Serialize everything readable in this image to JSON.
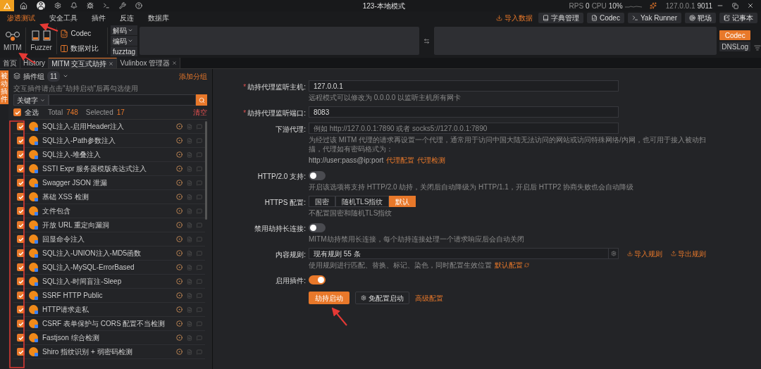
{
  "title_bar": {
    "title": "123-本地模式",
    "rps_label": "RPS",
    "rps": "0",
    "cpu_label": "CPU",
    "cpu": "10%",
    "host": "127.0.0.1",
    "port": "9011"
  },
  "ribbon_tabs": [
    {
      "label": "渗透测试",
      "selected": true
    },
    {
      "label": "安全工具",
      "selected": false
    },
    {
      "label": "插件",
      "selected": false
    },
    {
      "label": "反连",
      "selected": false
    },
    {
      "label": "数据库",
      "selected": false
    }
  ],
  "ribbon_tools": [
    {
      "label": "导入数据",
      "kind": "link"
    },
    {
      "label": "字典管理",
      "kind": "button"
    },
    {
      "label": "Codec",
      "kind": "button"
    },
    {
      "label": "Yak Runner",
      "kind": "button"
    },
    {
      "label": "靶场",
      "kind": "button"
    },
    {
      "label": "记事本",
      "kind": "button"
    }
  ],
  "ribbon": {
    "mitm": "MITM",
    "fuzzer": "Fuzzer",
    "codec": "Codec",
    "compare": "数据对比",
    "decode": "解码",
    "encode": "编码",
    "fuzztag": "fuzztag",
    "side_buttons": [
      {
        "label": "Codec",
        "selected": true
      },
      {
        "label": "DNSLog",
        "selected": false
      }
    ]
  },
  "page_tabs": [
    {
      "label": "首页",
      "selected": false,
      "closable": false
    },
    {
      "label": "History",
      "selected": false,
      "closable": false
    },
    {
      "label": "MITM 交互式劫持",
      "selected": true,
      "closable": true
    },
    {
      "label": "Vulinbox 管理器",
      "selected": false,
      "closable": true
    }
  ],
  "side_tab": "被动插件",
  "plugins": {
    "group_label": "插件组",
    "group_count": "11",
    "add_group": "添加分组",
    "hint": "交互插件请点击\"劫持启动\"后再勾选使用",
    "keyword": "关键字",
    "select_all_label": "全选",
    "select_all_checked": true,
    "total_label": "Total",
    "total": "748",
    "selected_label": "Selected",
    "selected": "17",
    "clear": "清空",
    "items": [
      {
        "name": "SQL注入-启用Header注入",
        "checked": true
      },
      {
        "name": "SQL注入-Path参数注入",
        "checked": true
      },
      {
        "name": "SQL注入-堆叠注入",
        "checked": true
      },
      {
        "name": "SSTI Expr 服务器模版表达式注入",
        "checked": true
      },
      {
        "name": "Swagger JSON 泄漏",
        "checked": true
      },
      {
        "name": "基础 XSS 检测",
        "checked": true
      },
      {
        "name": "文件包含",
        "checked": true
      },
      {
        "name": "开放 URL 重定向漏洞",
        "checked": true
      },
      {
        "name": "回显命令注入",
        "checked": true
      },
      {
        "name": "SQL注入-UNION注入-MD5函数",
        "checked": true
      },
      {
        "name": "SQL注入-MySQL-ErrorBased",
        "checked": true
      },
      {
        "name": "SQL注入-时间盲注-Sleep",
        "checked": true
      },
      {
        "name": "SSRF HTTP Public",
        "checked": true
      },
      {
        "name": "HTTP请求走私",
        "checked": true
      },
      {
        "name": "CSRF 表单保护与 CORS 配置不当检测",
        "checked": true
      },
      {
        "name": "Fastjson 综合检测",
        "checked": true
      },
      {
        "name": "Shiro 指纹识别 + 弱密码检测",
        "checked": true
      }
    ]
  },
  "form": {
    "rows": [
      {
        "kind": "input",
        "label": "劫持代理监听主机:",
        "required_mark": "*",
        "value": "127.0.0.1",
        "hint": "远程模式可以修改为 0.0.0.0 以监听主机所有网卡"
      },
      {
        "kind": "input",
        "label": "劫持代理监听端口:",
        "required_mark": "*",
        "value": "8083"
      },
      {
        "kind": "input",
        "label": "下游代理:",
        "placeholder": "例如 http://127.0.0.1:7890 或者 socks5://127.0.0.1:7890",
        "hint": "为经过该 MITM 代理的请求再设置一个代理，通常用于访问中国大陆无法访问的网站或访问特殊网络/内网，也可用于接入被动扫描，代理如有密码格式为：",
        "example": "http://user:pass@ip:port",
        "links": [
          "代理配置",
          "代理检测"
        ]
      },
      {
        "kind": "switch",
        "label": "HTTP/2.0 支持:",
        "on": false,
        "hint": "开启该选项将支持 HTTP/2.0 劫持，关闭后自动降级为 HTTP/1.1，开启后 HTTP2 协商失败也会自动降级"
      },
      {
        "kind": "segmented",
        "label": "HTTPS 配置:",
        "options": [
          {
            "label": "国密",
            "selected": false
          },
          {
            "label": "随机TLS指纹",
            "selected": false
          },
          {
            "label": "默认",
            "selected": true
          }
        ],
        "hint": "不配置国密和随机TLS指纹"
      },
      {
        "kind": "switch",
        "label": "禁用劫持长连接:",
        "on": false,
        "hint": "MITM劫持禁用长连接，每个劫持连接处理一个请求响应后会自动关闭"
      },
      {
        "kind": "rules",
        "label": "内容规则:",
        "value": "现有规则 55 条",
        "hint": "使用规则进行匹配、替换、标记、染色，同时配置生效位置",
        "link": "默认配置",
        "actions": [
          "导入规则",
          "导出规则"
        ]
      },
      {
        "kind": "switch",
        "label": "启用插件:",
        "on": true
      }
    ],
    "buttons": [
      {
        "label": "劫持启动",
        "kind": "primary"
      },
      {
        "label": "免配置启动",
        "kind": "default"
      },
      {
        "label": "高级配置",
        "kind": "link"
      }
    ]
  }
}
